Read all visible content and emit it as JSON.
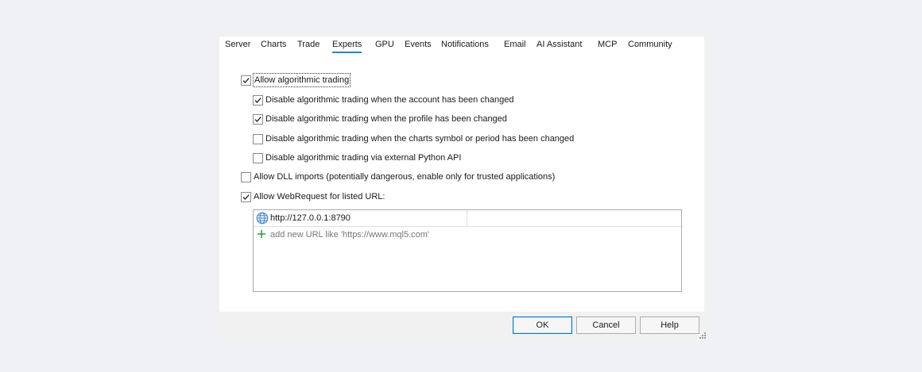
{
  "tabs": [
    {
      "label": "Server",
      "active": false
    },
    {
      "label": "Charts",
      "active": false
    },
    {
      "label": "Trade",
      "active": false
    },
    {
      "label": "Experts",
      "active": true
    },
    {
      "label": "GPU",
      "active": false
    },
    {
      "label": "Events",
      "active": false
    },
    {
      "label": "Notifications",
      "active": false
    },
    {
      "label": "Email",
      "active": false
    },
    {
      "label": "AI Assistant",
      "active": false
    },
    {
      "label": "MCP",
      "active": false
    },
    {
      "label": "Community",
      "active": false
    }
  ],
  "options": {
    "allow_algo": {
      "label": "Allow algorithmic trading",
      "checked": true
    },
    "disable_account": {
      "label": "Disable algorithmic trading when the account has been changed",
      "checked": true
    },
    "disable_profile": {
      "label": "Disable algorithmic trading when the profile has been changed",
      "checked": true
    },
    "disable_symbol": {
      "label": "Disable algorithmic trading when the charts symbol or period has been changed",
      "checked": false
    },
    "disable_python": {
      "label": "Disable algorithmic trading via external Python API",
      "checked": false
    },
    "allow_dll": {
      "label": "Allow DLL imports (potentially dangerous, enable only for trusted applications)",
      "checked": false
    },
    "allow_webrequest": {
      "label": "Allow WebRequest for listed URL:",
      "checked": true
    }
  },
  "url_list": {
    "urls": [
      "http://127.0.0.1:8790"
    ],
    "add_placeholder": "add new URL like 'https://www.mql5.com'"
  },
  "buttons": {
    "ok": "OK",
    "cancel": "Cancel",
    "help": "Help"
  },
  "colors": {
    "accent": "#1f87c8",
    "add_icon": "#2e9e3e"
  }
}
